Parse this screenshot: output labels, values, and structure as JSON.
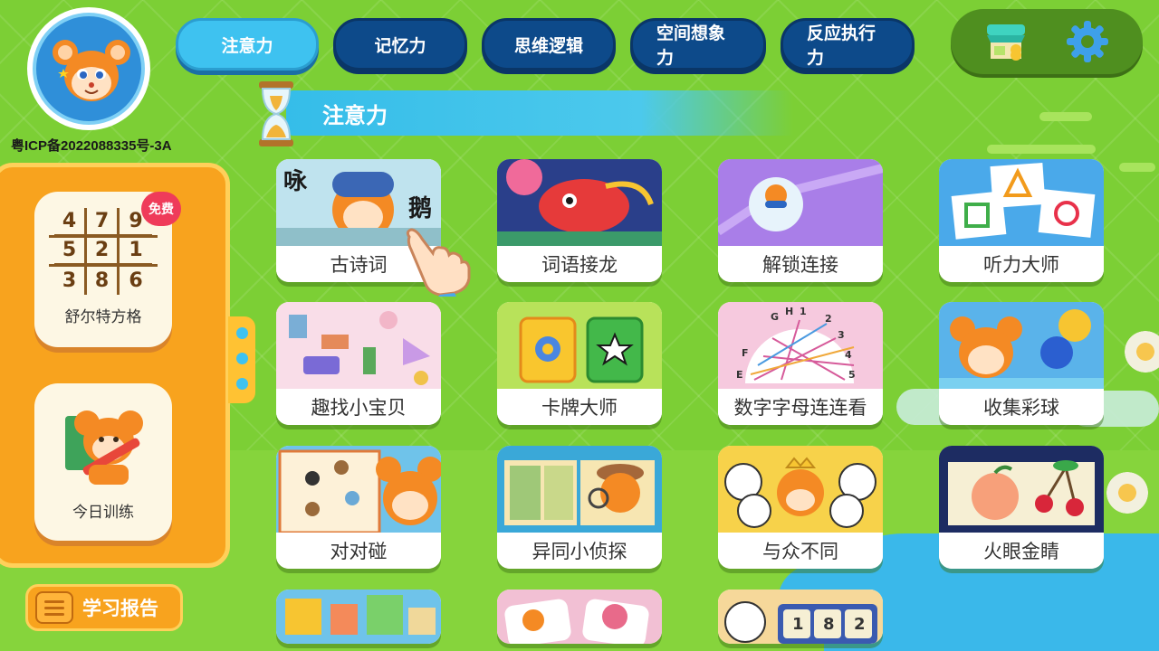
{
  "icp": "粤ICP备2022088335号-3A",
  "tabs": [
    {
      "label": "注意力",
      "active": true
    },
    {
      "label": "记忆力",
      "active": false
    },
    {
      "label": "思维逻辑",
      "active": false
    },
    {
      "label": "空间想象力",
      "active": false
    },
    {
      "label": "反应执行力",
      "active": false
    }
  ],
  "section": {
    "title": "注意力"
  },
  "sidebar": {
    "sudoku": {
      "label": "舒尔特方格",
      "badge": "免费",
      "grid": [
        "4",
        "7",
        "9",
        "5",
        "2",
        "1",
        "3",
        "8",
        "6"
      ]
    },
    "daily": {
      "label": "今日训练"
    },
    "report": {
      "label": "学习报告"
    }
  },
  "games": [
    {
      "label": "古诗词"
    },
    {
      "label": "词语接龙"
    },
    {
      "label": "解锁连接"
    },
    {
      "label": "听力大师"
    },
    {
      "label": "趣找小宝贝"
    },
    {
      "label": "卡牌大师"
    },
    {
      "label": "数字字母连连看"
    },
    {
      "label": "收集彩球"
    },
    {
      "label": "对对碰"
    },
    {
      "label": "异同小侦探"
    },
    {
      "label": "与众不同"
    },
    {
      "label": "火眼金睛"
    }
  ],
  "card_text": {
    "poem_chars": [
      "咏",
      "鹅"
    ],
    "number_tiles": [
      "1",
      "8",
      "2"
    ],
    "letters": [
      "G",
      "H",
      "1",
      "2",
      "3",
      "4",
      "5",
      "F",
      "E"
    ]
  },
  "colors": {
    "background": "#7ccf35",
    "tab_active": "#3ec2f0",
    "tab_inactive": "#0d4a8a",
    "panel": "#f8a31e",
    "badge": "#ef3b5a"
  },
  "icons": {
    "shop": "shop-icon",
    "settings": "gear-icon",
    "hourglass": "hourglass-icon",
    "report": "list-icon",
    "hand": "pointer-hand-icon"
  }
}
